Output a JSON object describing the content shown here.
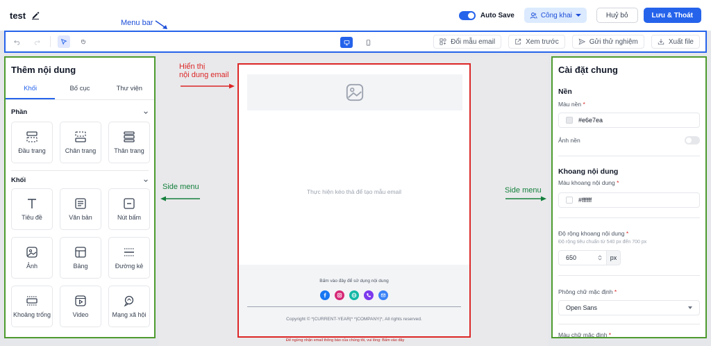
{
  "header": {
    "title": "test",
    "autosave_label": "Auto Save",
    "visibility_label": "Công khai",
    "cancel_label": "Huỷ bỏ",
    "save_label": "Lưu & Thoát"
  },
  "annotations": {
    "menu_bar": "Menu bar",
    "email_content_line1": "Hiển thị",
    "email_content_line2": "nội dung email",
    "side_menu_left": "Side menu",
    "side_menu_right": "Side menu"
  },
  "toolbar": {
    "change_template": "Đổi mẫu email",
    "preview": "Xem trước",
    "send_test": "Gửi thử nghiệm",
    "export": "Xuất file"
  },
  "left_panel": {
    "title": "Thêm nội dung",
    "tabs": [
      "Khối",
      "Bố cục",
      "Thư viện"
    ],
    "section_parts": "Phần",
    "parts": [
      "Đầu trang",
      "Chân trang",
      "Thân trang"
    ],
    "section_blocks": "Khối",
    "blocks": [
      "Tiêu đề",
      "Văn bản",
      "Nút bấm",
      "Ảnh",
      "Bảng",
      "Đường kẻ",
      "Khoảng trống",
      "Video",
      "Mạng xã hội"
    ]
  },
  "canvas": {
    "placeholder": "Thực hiện kéo thả để tạo mẫu email",
    "footer_cta": "Bấm vào đây để sử dụng nội dung",
    "copyright": "Copyright © *|CURRENT-YEAR|* *|COMPANY|*, All rights reserved.",
    "below_text": "Để ngừng nhận email thông báo của chúng tôi, vui lòng: Bấm vào đây"
  },
  "right_panel": {
    "title": "Cài đặt chung",
    "bg_section": "Nền",
    "bg_color_label": "Màu nền",
    "bg_color_value": "#e6e7ea",
    "bg_image_label": "Ảnh nền",
    "content_section": "Khoang nội dung",
    "content_color_label": "Màu khoang nội dung",
    "content_color_value": "#ffffff",
    "width_label": "Độ rộng khoang nội dung",
    "width_hint": "Độ rộng tiêu chuẩn từ 540 px đến 700 px",
    "width_value": "650",
    "width_unit": "px",
    "font_label": "Phông chữ mặc định",
    "font_value": "Open Sans",
    "text_color_label": "Màu chữ mặc định"
  },
  "colors": {
    "accent": "#2563eb",
    "annotation_blue": "#1d4ed8",
    "annotation_red": "#dc2626",
    "annotation_green": "#4d9a2e"
  }
}
